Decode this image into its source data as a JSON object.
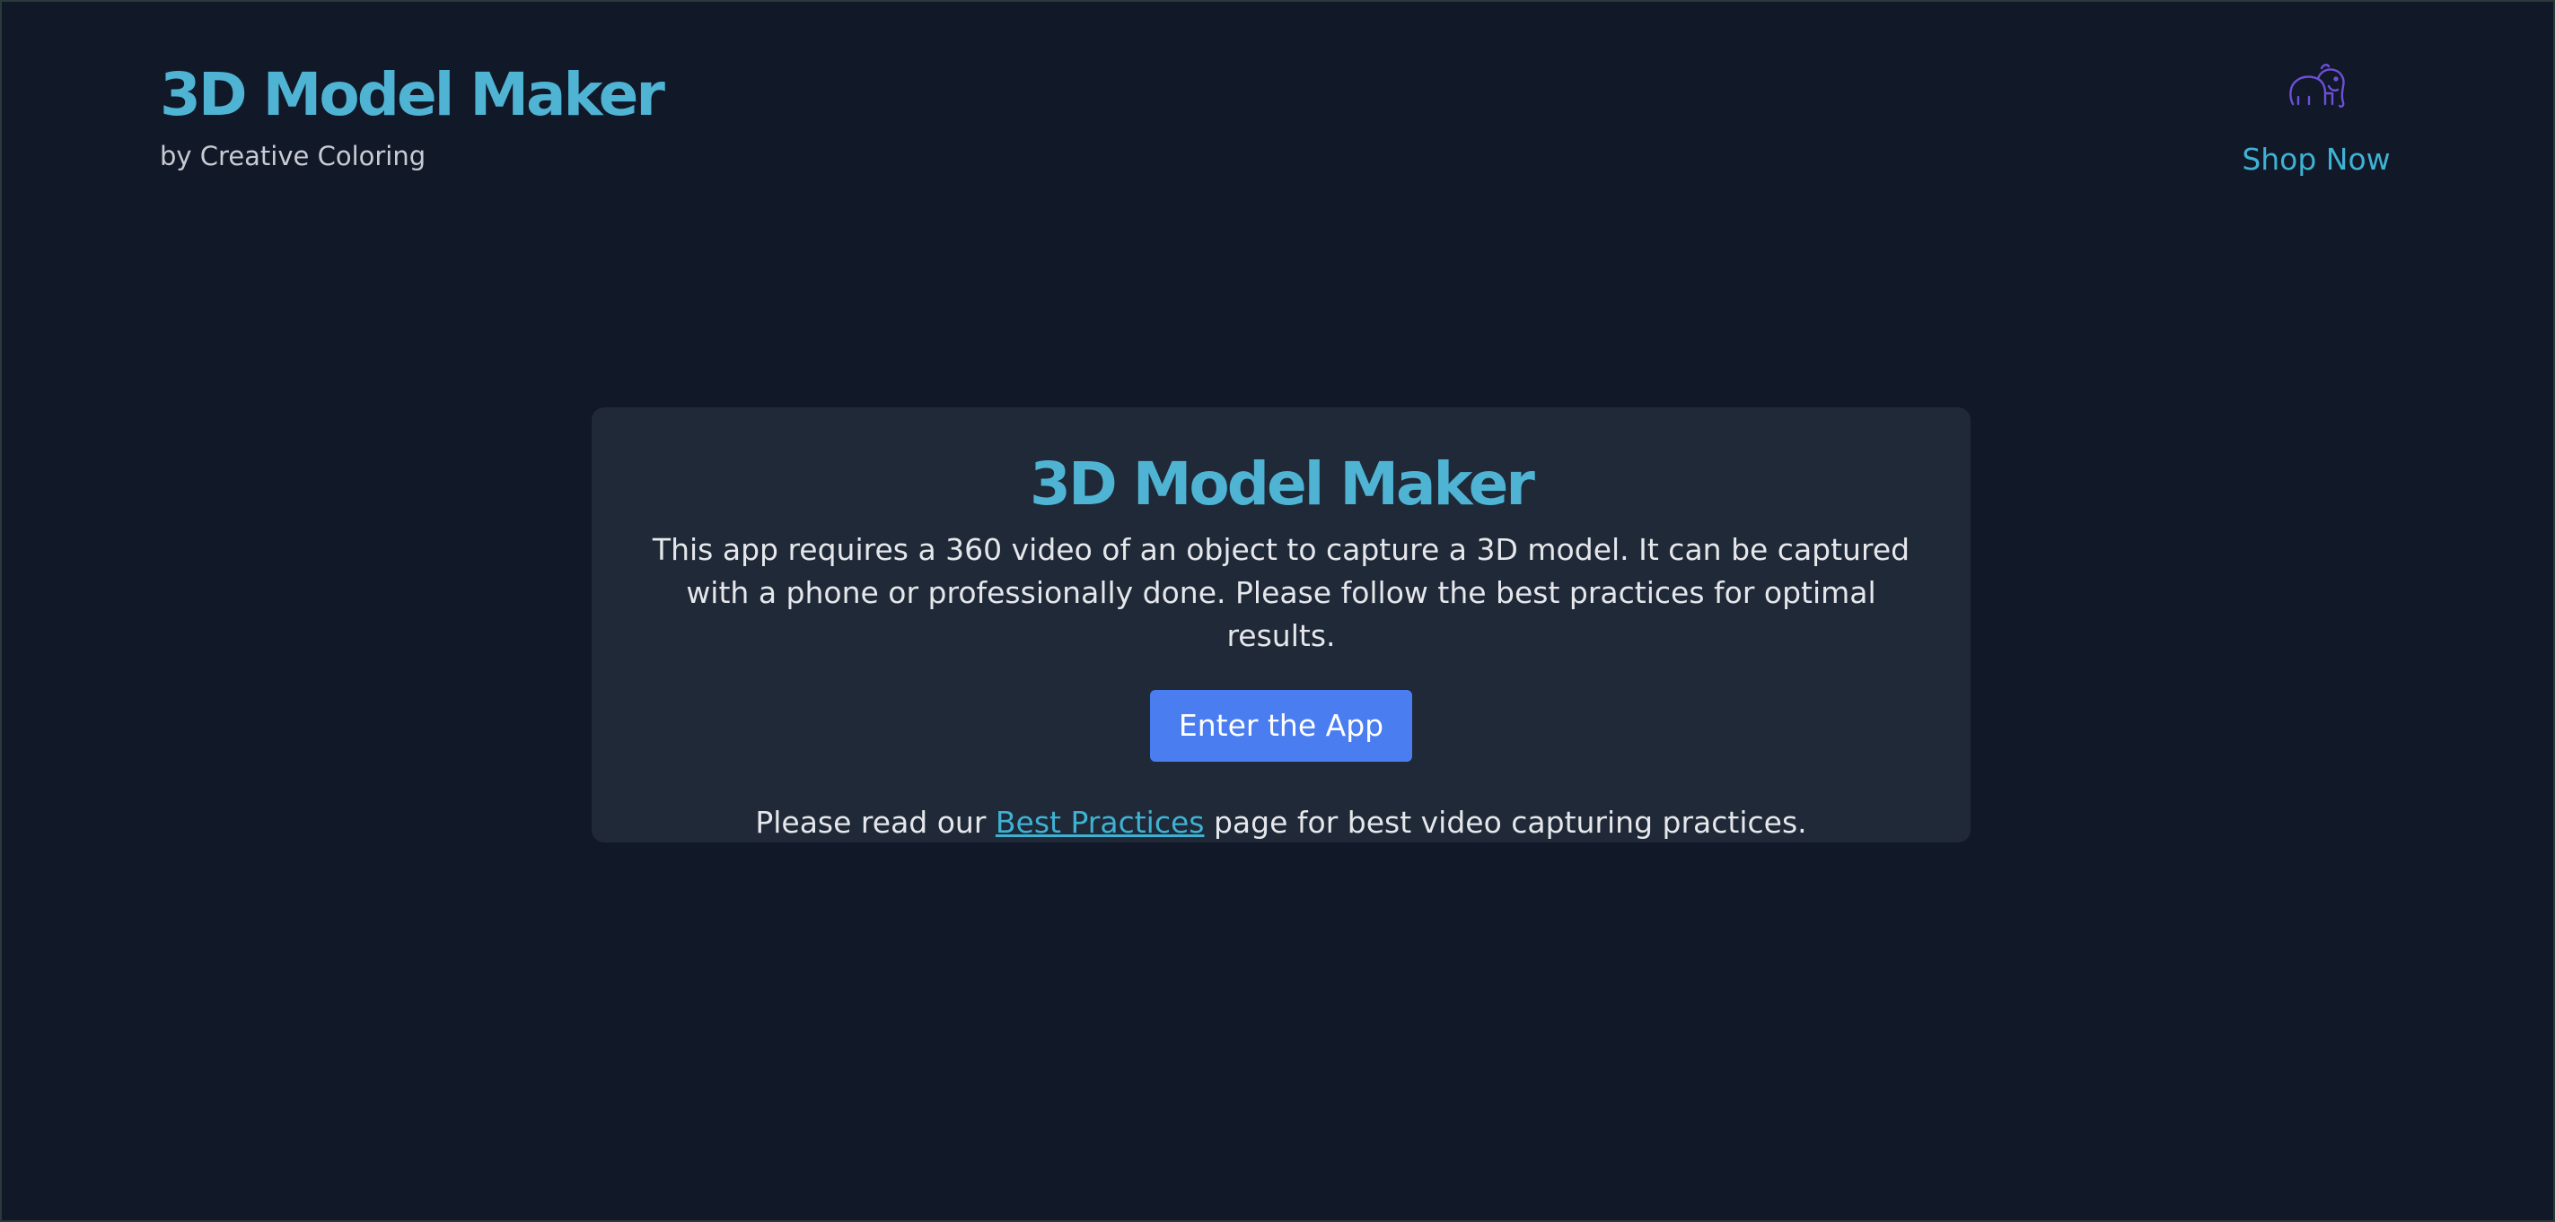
{
  "header": {
    "title": "3D Model Maker",
    "subtitle": "by Creative Coloring",
    "shop_icon": "elephant-icon",
    "shop_label": "Shop Now"
  },
  "card": {
    "title": "3D Model Maker",
    "description": "This app requires a 360 video of an object to capture a 3D model. It can be captured with a phone or professionally done. Please follow the best practices for optimal results.",
    "button_label": "Enter the App",
    "note_prefix": "Please read our",
    "note_link": "Best Practices",
    "note_suffix": "page for best video capturing practices."
  },
  "colors": {
    "background": "#111827",
    "card": "#1f2937",
    "accent": "#4fb3d3",
    "button": "#4a7ef0",
    "icon": "#6d4fd8"
  }
}
